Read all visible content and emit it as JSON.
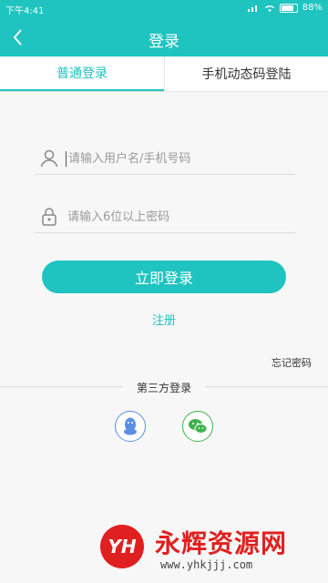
{
  "status_bar": {
    "time": "下午4:41",
    "battery": "88%"
  },
  "app_bar": {
    "title": "登录"
  },
  "tabs": [
    {
      "label": "普通登录",
      "active": true
    },
    {
      "label": "手机动态码登陆",
      "active": false
    }
  ],
  "form": {
    "username_placeholder": "请输入用户名/手机号码",
    "password_placeholder": "请输入6位以上密码",
    "login_label": "立即登录",
    "register_label": "注册",
    "forgot_label": "忘记密码"
  },
  "third_party": {
    "label": "第三方登录",
    "providers": [
      "qq-icon",
      "wechat-icon"
    ]
  },
  "watermark": {
    "logo_text": "YH",
    "brand": "永辉资源网",
    "url": "www.yhkjjj.com"
  },
  "colors": {
    "primary": "#1fc3bf",
    "qq": "#5b8fe6",
    "wechat": "#3cb34a",
    "watermark": "#e02020"
  }
}
